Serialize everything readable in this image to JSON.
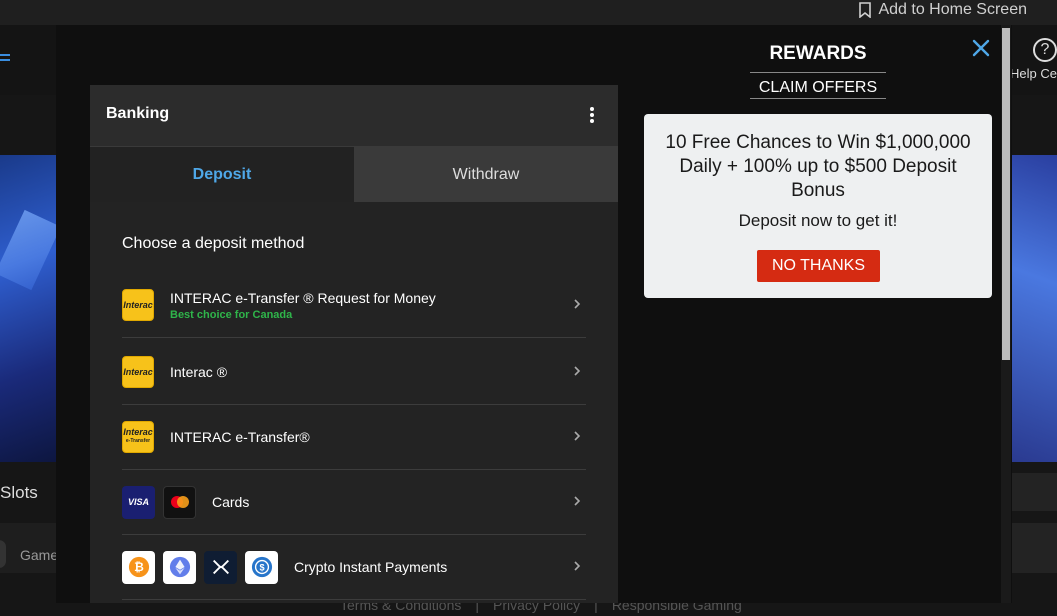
{
  "browser": {
    "add_home_label": "Add to Home Screen"
  },
  "background": {
    "help_label": "Help Ce",
    "help_glyph": "?",
    "slots_label": "Slots",
    "games_label": "Game",
    "footer_links": [
      "Terms & Conditions",
      "|",
      "Privacy Policy",
      "|",
      "Responsible Gaming"
    ]
  },
  "rewards": {
    "title": "REWARDS",
    "claim_label": "CLAIM OFFERS",
    "offer_headline": "10 Free Chances to Win $1,000,000 Daily + 100% up to $500 Deposit Bonus",
    "offer_sub": "Deposit now to get it!",
    "no_thanks_label": "NO THANKS"
  },
  "banking": {
    "title": "Banking",
    "tabs": [
      {
        "label": "Deposit",
        "active": true
      },
      {
        "label": "Withdraw",
        "active": false
      }
    ],
    "choose_label": "Choose a deposit method",
    "methods": [
      {
        "name": "INTERAC e-Transfer ® Request for Money",
        "note": "Best choice for Canada",
        "logos": [
          "interac-logo"
        ]
      },
      {
        "name": "Interac ®",
        "logos": [
          "interac-logo"
        ]
      },
      {
        "name": "INTERAC e-Transfer®",
        "logos": [
          "interac-etransfer-logo"
        ]
      },
      {
        "name": "Cards",
        "logos": [
          "visa-logo",
          "mastercard-logo"
        ]
      },
      {
        "name": "Crypto Instant Payments",
        "logos": [
          "bitcoin-logo",
          "ethereum-logo",
          "xrp-logo",
          "usdc-logo"
        ]
      }
    ],
    "logo_text": {
      "interac": "Interac",
      "visa": "VISA",
      "etransfer": "e-Transfer"
    }
  },
  "colors": {
    "accent_blue": "#4fa8e8",
    "button_red": "#d52b12",
    "success_green": "#2fb54a",
    "interac_yellow": "#f7c21a"
  }
}
